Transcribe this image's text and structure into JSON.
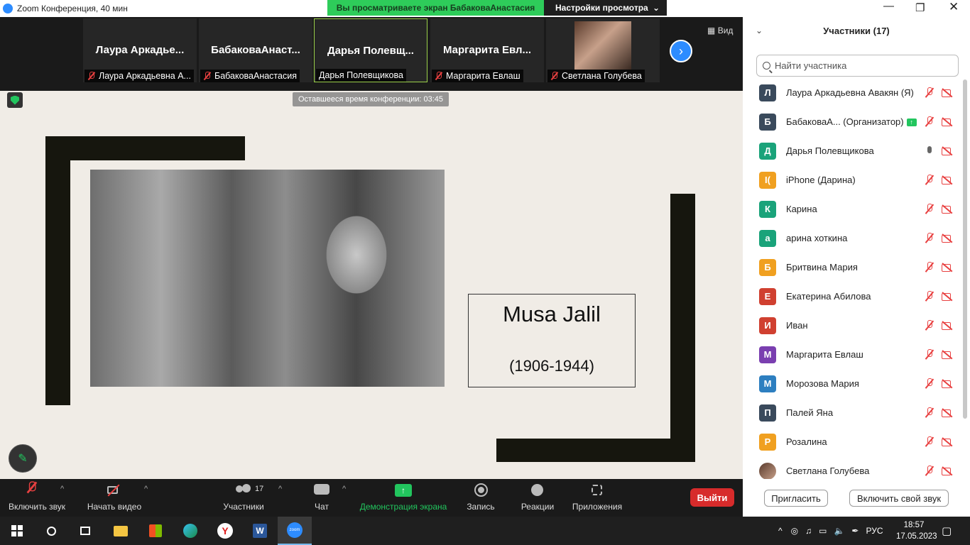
{
  "window": {
    "title": "Zoom Конференция, 40 мин",
    "share_banner": "Вы просматриваете экран БабаковаАнастасия",
    "view_settings": "Настройки просмотра",
    "view_label": "Вид",
    "timer": "Оставшееся время конференции: 03:45"
  },
  "thumbnails": [
    {
      "big": "Лаура  Аркадье...",
      "label": "Лаура Аркадьевна А..."
    },
    {
      "big": "БабаковаАнаст...",
      "label": "БабаковаАнастасия"
    },
    {
      "big": "Дарья  Полевщ...",
      "label": "Дарья Полевщикова"
    },
    {
      "big": "Маргарита  Евл...",
      "label": "Маргарита Евлаш"
    },
    {
      "big": "",
      "label": "Светлана Голубева"
    }
  ],
  "slide": {
    "name": "Musa Jalil",
    "years": "(1906-1944)"
  },
  "toolbar": {
    "unmute": "Включить звук",
    "start_video": "Начать видео",
    "participants": "Участники",
    "participants_count": "17",
    "chat": "Чат",
    "share": "Демонстрация экрана",
    "record": "Запись",
    "reactions": "Реакции",
    "apps": "Приложения",
    "leave": "Выйти"
  },
  "panel": {
    "title": "Участники (17)",
    "search_placeholder": "Найти участника",
    "invite": "Пригласить",
    "unmute_self": "Включить свой звук",
    "participants": [
      {
        "initial": "Л",
        "name": "Лаура Аркадьевна Авакян (Я)",
        "color": "#3a4a5c",
        "mic": "off",
        "host": false
      },
      {
        "initial": "Б",
        "name": "БабаковаА...  (Организатор)",
        "color": "#3a4a5c",
        "mic": "off",
        "host": true
      },
      {
        "initial": "Д",
        "name": "Дарья Полевщикова",
        "color": "#1aa37a",
        "mic": "on",
        "host": false
      },
      {
        "initial": "I(",
        "name": "iPhone (Дарина)",
        "color": "#f0a020",
        "mic": "off",
        "host": false
      },
      {
        "initial": "К",
        "name": "Карина",
        "color": "#1aa37a",
        "mic": "off",
        "host": false
      },
      {
        "initial": "а",
        "name": "арина хоткина",
        "color": "#1aa37a",
        "mic": "off",
        "host": false
      },
      {
        "initial": "Б",
        "name": "Бритвина Мария",
        "color": "#f0a020",
        "mic": "off",
        "host": false
      },
      {
        "initial": "Е",
        "name": "Екатерина Абилова",
        "color": "#d04030",
        "mic": "off",
        "host": false
      },
      {
        "initial": "И",
        "name": "Иван",
        "color": "#d04030",
        "mic": "off",
        "host": false
      },
      {
        "initial": "М",
        "name": "Маргарита Евлаш",
        "color": "#7a3fb0",
        "mic": "off",
        "host": false
      },
      {
        "initial": "М",
        "name": "Морозова Мария",
        "color": "#2d7fc0",
        "mic": "off",
        "host": false
      },
      {
        "initial": "П",
        "name": "Палей Яна",
        "color": "#3a4a5c",
        "mic": "off",
        "host": false
      },
      {
        "initial": "Р",
        "name": "Розалина",
        "color": "#f0a020",
        "mic": "off",
        "host": false
      },
      {
        "initial": "",
        "name": "Светлана Голубева",
        "color": "#6b3a2a",
        "mic": "off",
        "host": false
      }
    ]
  },
  "taskbar": {
    "lang": "РУС",
    "time": "18:57",
    "date": "17.05.2023"
  },
  "colors": {
    "accent": "#2d8cff",
    "share_green": "#2ecc5a",
    "leave_red": "#d72b2b",
    "mic_off_red": "#e84040"
  }
}
